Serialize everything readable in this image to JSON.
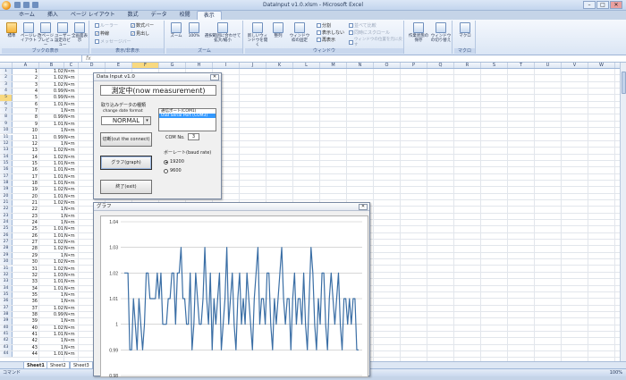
{
  "window": {
    "title": "DataInput v1.0.xlsm - Microsoft Excel",
    "min": "–",
    "max": "□",
    "close": "✕"
  },
  "tabs": [
    "ホーム",
    "挿入",
    "ページ レイアウト",
    "数式",
    "データ",
    "校閲",
    "表示"
  ],
  "active_tab": "表示",
  "ribbon": {
    "groups": [
      {
        "label": "ブックの表示",
        "buttons": [
          "標準",
          "ページレイアウト",
          "改ページプレビュー",
          "ユーザー設定のビュー",
          "全画面表示"
        ]
      },
      {
        "label": "表示/非表示",
        "checks": [
          {
            "label": "ルーラー",
            "checked": false,
            "dim": true
          },
          {
            "label": "枠線",
            "checked": true
          },
          {
            "label": "メッセージバー",
            "checked": false,
            "dim": true
          },
          {
            "label": "数式バー",
            "checked": true
          },
          {
            "label": "見出し",
            "checked": true
          }
        ]
      },
      {
        "label": "ズーム",
        "buttons": [
          "ズーム",
          "100%",
          "選択範囲に合わせて拡大/縮小"
        ]
      },
      {
        "label": "ウィンドウ",
        "buttons": [
          "新しいウィンドウを開く",
          "整列",
          "ウィンドウ枠の固定"
        ],
        "small": [
          "分割",
          "表示しない",
          "再表示",
          "並べて比較",
          "同時にスクロール",
          "ウィンドウの位置を元に戻す"
        ]
      },
      {
        "label": "",
        "buttons": [
          "作業状態の保存",
          "ウィンドウの切り替え"
        ]
      },
      {
        "label": "マクロ",
        "buttons": [
          "マクロ"
        ]
      }
    ]
  },
  "namebox": "",
  "fx": "fx",
  "columns": [
    "A",
    "B",
    "C",
    "D",
    "E",
    "F",
    "G",
    "H",
    "I",
    "J",
    "K",
    "L",
    "M",
    "N",
    "O",
    "P",
    "Q",
    "R",
    "S",
    "T",
    "U",
    "V",
    "W"
  ],
  "selected_column": "F",
  "selected_row": 5,
  "rows": [
    {
      "n": 1,
      "a": "1",
      "b": "1.02",
      "c": "N•m"
    },
    {
      "n": 2,
      "a": "2",
      "b": "1.02",
      "c": "N•m"
    },
    {
      "n": 3,
      "a": "3",
      "b": "1.02",
      "c": "N•m"
    },
    {
      "n": 4,
      "a": "4",
      "b": "0.99",
      "c": "N•m"
    },
    {
      "n": 5,
      "a": "5",
      "b": "0.99",
      "c": "N•m"
    },
    {
      "n": 6,
      "a": "6",
      "b": "1.01",
      "c": "N•m"
    },
    {
      "n": 7,
      "a": "7",
      "b": "1",
      "c": "N•m"
    },
    {
      "n": 8,
      "a": "8",
      "b": "0.99",
      "c": "N•m"
    },
    {
      "n": 9,
      "a": "9",
      "b": "1.01",
      "c": "N•m"
    },
    {
      "n": 10,
      "a": "10",
      "b": "1",
      "c": "N•m"
    },
    {
      "n": 11,
      "a": "11",
      "b": "0.99",
      "c": "N•m"
    },
    {
      "n": 12,
      "a": "12",
      "b": "1",
      "c": "N•m"
    },
    {
      "n": 13,
      "a": "13",
      "b": "1.02",
      "c": "N•m"
    },
    {
      "n": 14,
      "a": "14",
      "b": "1.02",
      "c": "N•m"
    },
    {
      "n": 15,
      "a": "15",
      "b": "1.01",
      "c": "N•m"
    },
    {
      "n": 16,
      "a": "16",
      "b": "1.01",
      "c": "N•m"
    },
    {
      "n": 17,
      "a": "17",
      "b": "1.01",
      "c": "N•m"
    },
    {
      "n": 18,
      "a": "18",
      "b": "1.01",
      "c": "N•m"
    },
    {
      "n": 19,
      "a": "19",
      "b": "1.02",
      "c": "N•m"
    },
    {
      "n": 20,
      "a": "20",
      "b": "1.01",
      "c": "N•m"
    },
    {
      "n": 21,
      "a": "21",
      "b": "1.02",
      "c": "N•m"
    },
    {
      "n": 22,
      "a": "22",
      "b": "1",
      "c": "N•m"
    },
    {
      "n": 23,
      "a": "23",
      "b": "1",
      "c": "N•m"
    },
    {
      "n": 24,
      "a": "24",
      "b": "1",
      "c": "N•m"
    },
    {
      "n": 25,
      "a": "25",
      "b": "1.01",
      "c": "N•m"
    },
    {
      "n": 26,
      "a": "26",
      "b": "1.01",
      "c": "N•m"
    },
    {
      "n": 27,
      "a": "27",
      "b": "1.02",
      "c": "N•m"
    },
    {
      "n": 28,
      "a": "28",
      "b": "1.02",
      "c": "N•m"
    },
    {
      "n": 29,
      "a": "29",
      "b": "1",
      "c": "N•m"
    },
    {
      "n": 30,
      "a": "30",
      "b": "1.02",
      "c": "N•m"
    },
    {
      "n": 31,
      "a": "31",
      "b": "1.02",
      "c": "N•m"
    },
    {
      "n": 32,
      "a": "32",
      "b": "1.03",
      "c": "N•m"
    },
    {
      "n": 33,
      "a": "33",
      "b": "1.01",
      "c": "N•m"
    },
    {
      "n": 34,
      "a": "34",
      "b": "1.01",
      "c": "N•m"
    },
    {
      "n": 35,
      "a": "35",
      "b": "1",
      "c": "N•m"
    },
    {
      "n": 36,
      "a": "36",
      "b": "1",
      "c": "N•m"
    },
    {
      "n": 37,
      "a": "37",
      "b": "1.02",
      "c": "N•m"
    },
    {
      "n": 38,
      "a": "38",
      "b": "0.99",
      "c": "N•m"
    },
    {
      "n": 39,
      "a": "39",
      "b": "1",
      "c": "N•m"
    },
    {
      "n": 40,
      "a": "40",
      "b": "1.02",
      "c": "N•m"
    },
    {
      "n": 41,
      "a": "41",
      "b": "1.01",
      "c": "N•m"
    },
    {
      "n": 42,
      "a": "42",
      "b": "1",
      "c": "N•m"
    },
    {
      "n": 43,
      "a": "43",
      "b": "1",
      "c": "N•m"
    },
    {
      "n": 44,
      "a": "44",
      "b": "1.01",
      "c": "N•m"
    }
  ],
  "sheets": [
    "Sheet1",
    "Sheet2",
    "Sheet3"
  ],
  "status": {
    "mode": "コマンド",
    "zoom": "100%"
  },
  "form": {
    "title": "Data Input v1.0",
    "close": "✕",
    "message": "測定中(now measurement)",
    "format_label_jp": "取り込みデータの種類",
    "format_label_en": "change date format",
    "format_value": "NORMAL",
    "port_label": "通信ポート(COM1)",
    "port_selected": "USB Serial Port (COM3)",
    "cut_button": "切断(cut the connect)",
    "com_label": "COM No.",
    "com_value": "3",
    "graph_button": "グラフ(graph)",
    "baud_label": "ボーレート(baud rate)",
    "baud_options": [
      {
        "label": "19200",
        "checked": true
      },
      {
        "label": "9600",
        "checked": false
      }
    ],
    "exit_button": "終了(exit)"
  },
  "graph_window": {
    "title": "グラフ",
    "close": "✕"
  },
  "chart_data": {
    "type": "line",
    "title": "",
    "xlabel": "",
    "ylabel": "",
    "ylim": [
      0.98,
      1.04
    ],
    "y_ticks": [
      "1.04",
      "1.03",
      "1.02",
      "1.01",
      "1",
      "0.99",
      "0.98"
    ],
    "grid": true,
    "series": [
      {
        "name": "",
        "color": "#3a6ea5",
        "values": [
          1.02,
          1.02,
          1.02,
          0.99,
          0.99,
          1.01,
          1,
          0.99,
          1.01,
          1,
          0.99,
          1,
          1.02,
          1.02,
          1.01,
          1.01,
          1.01,
          1.01,
          1.02,
          1.01,
          1.02,
          1,
          1,
          1,
          1.01,
          1.01,
          1.02,
          1.02,
          1,
          1.02,
          1.02,
          1.03,
          1.01,
          1.01,
          1,
          1,
          1.02,
          0.99,
          1,
          1.02,
          1.01,
          1,
          1,
          1.01,
          1.03,
          1.01,
          1,
          1.02,
          0.99,
          1.01,
          1,
          1.01,
          1.02,
          0.99,
          1,
          1.01,
          1.03,
          1,
          1.01,
          1.02,
          1,
          0.99,
          1.01,
          1.02,
          1,
          1.01,
          1,
          1.02,
          1.01,
          1,
          0.99,
          1.01,
          1.02,
          1.03,
          1,
          1.01,
          1.01,
          1,
          1.02,
          1.02,
          1,
          0.99,
          1.01,
          1,
          1.01,
          1.02,
          1.03,
          1.01,
          1,
          1.01,
          1.01,
          0.99,
          1.01,
          1.02,
          1,
          1.01,
          1.01,
          1,
          1.02,
          1,
          0.99,
          1.01,
          1.03,
          1.02,
          1,
          0.99,
          1.01,
          1,
          1.02,
          1.02,
          1,
          0.99,
          1.01,
          1.02,
          1.01,
          1,
          1.01,
          1.02,
          1,
          0.99,
          1.01,
          1.01,
          1,
          1.01,
          1,
          1.01,
          1.01,
          0.99,
          0.99
        ]
      }
    ]
  }
}
